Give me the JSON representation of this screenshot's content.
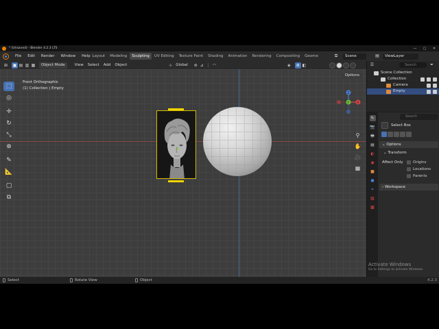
{
  "window": {
    "title": "* (Unsaved) - Blender 4.2.3 LTS",
    "min": "—",
    "max": "▢",
    "close": "✕"
  },
  "menu": [
    "File",
    "Edit",
    "Render",
    "Window",
    "Help"
  ],
  "workspaces": [
    "Layout",
    "Modeling",
    "Sculpting",
    "UV Editing",
    "Texture Paint",
    "Shading",
    "Animation",
    "Rendering",
    "Compositing",
    "Geome"
  ],
  "active_workspace": "Sculpting",
  "scene": "Scene",
  "view_layer": "ViewLayer",
  "viewport_header": {
    "mode": "Object Mode",
    "menus": [
      "View",
      "Select",
      "Add",
      "Object"
    ],
    "transform": "Global"
  },
  "viewport": {
    "view_name": "Front Orthographic",
    "collection_info": "(1) Collection | Empty",
    "options": "Options",
    "gizmo": {
      "x": "X",
      "y": "Y",
      "z": "Z"
    }
  },
  "statusbar": {
    "select": "Select",
    "rotate": "Rotate View",
    "object": "Object",
    "version": "4.2.3"
  },
  "outliner": {
    "search_placeholder": "Search",
    "root": "Scene Collection",
    "items": [
      {
        "name": "Collection",
        "color": "#d0d0d0"
      },
      {
        "name": "Camera",
        "color": "#e08a3a"
      },
      {
        "name": "Empty",
        "color": "#e08a3a"
      }
    ]
  },
  "properties": {
    "search_placeholder": "Search",
    "tool_name": "Select Box",
    "options_panel": "Options",
    "transform_sub": "Transform",
    "affect_only": "Affect Only",
    "checkboxes": [
      "Origins",
      "Locations",
      "Parents"
    ],
    "workspace_panel": "Workspace"
  },
  "watermark": {
    "title": "Activate Windows",
    "subtitle": "Go to Settings to activate Windows."
  },
  "colors": {
    "accent": "#4772b3",
    "selection": "#f0d400",
    "brand": "#e87d0d"
  }
}
